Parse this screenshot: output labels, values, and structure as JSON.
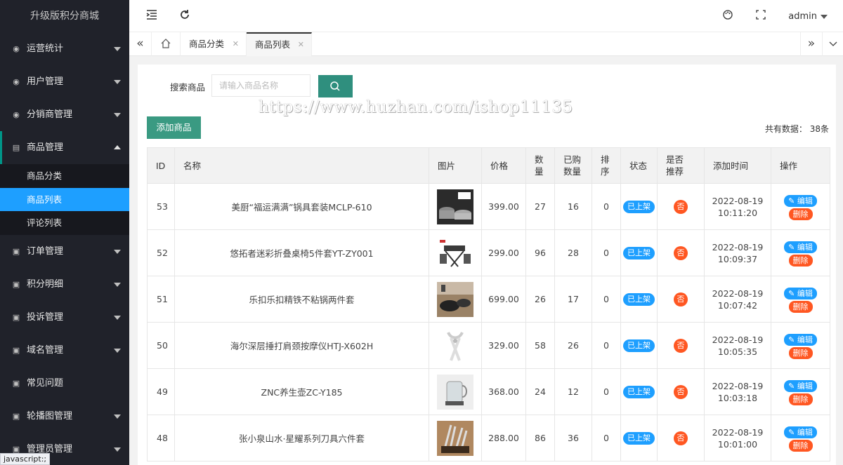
{
  "sidebar": {
    "logo": "升级版积分商城",
    "items": [
      {
        "label": "运营统计"
      },
      {
        "label": "用户管理"
      },
      {
        "label": "分销商管理"
      },
      {
        "label": "商品管理",
        "sub": [
          "商品分类",
          "商品列表",
          "评论列表"
        ]
      },
      {
        "label": "订单管理"
      },
      {
        "label": "积分明细"
      },
      {
        "label": "投诉管理"
      },
      {
        "label": "域名管理"
      },
      {
        "label": "常见问题"
      },
      {
        "label": "轮播图管理"
      },
      {
        "label": "管理员管理"
      }
    ]
  },
  "header": {
    "user": "admin"
  },
  "tabs": [
    {
      "label": "商品分类"
    },
    {
      "label": "商品列表"
    }
  ],
  "search": {
    "label": "搜索商品",
    "placeholder": "请输入商品名称"
  },
  "watermark": "https://www.huzhan.com/ishop11135",
  "add_button": "添加商品",
  "total": "共有数据： 38条",
  "table": {
    "headers": {
      "id": "ID",
      "name": "名称",
      "image": "图片",
      "price": "价格",
      "qty_1": "数",
      "qty_2": "量",
      "bought_1": "已购",
      "bought_2": "数量",
      "sort_1": "排",
      "sort_2": "序",
      "status": "状态",
      "rec_1": "是否",
      "rec_2": "推荐",
      "time": "添加时间",
      "ops": "操作"
    },
    "status_label": "已上架",
    "rec_label": "否",
    "edit_label": "✎ 编辑",
    "delete_label": "删除",
    "rows": [
      {
        "id": "53",
        "name": "美厨“福运满满”锅具套装MCLP-610",
        "price": "399.00",
        "qty": "27",
        "bought": "16",
        "sort": "0",
        "date": "2022-08-19",
        "time": "10:11:20",
        "img": "cookware-set"
      },
      {
        "id": "52",
        "name": "悠拓者迷彩折叠桌椅5件套YT-ZY001",
        "price": "299.00",
        "qty": "96",
        "bought": "28",
        "sort": "0",
        "date": "2022-08-19",
        "time": "10:09:37",
        "img": "folding-table"
      },
      {
        "id": "51",
        "name": "乐扣乐扣精铁不粘锅两件套",
        "price": "699.00",
        "qty": "26",
        "bought": "17",
        "sort": "0",
        "date": "2022-08-19",
        "time": "10:07:42",
        "img": "pans"
      },
      {
        "id": "50",
        "name": "海尔深层捶打肩颈按摩仪HTJ-X602H",
        "price": "329.00",
        "qty": "58",
        "bought": "26",
        "sort": "0",
        "date": "2022-08-19",
        "time": "10:05:35",
        "img": "massager"
      },
      {
        "id": "49",
        "name": "ZNC养生壶ZC-Y185",
        "price": "368.00",
        "qty": "24",
        "bought": "12",
        "sort": "0",
        "date": "2022-08-19",
        "time": "10:03:18",
        "img": "kettle"
      },
      {
        "id": "48",
        "name": "张小泉山水·星耀系列刀具六件套",
        "price": "288.00",
        "qty": "86",
        "bought": "36",
        "sort": "0",
        "date": "2022-08-19",
        "time": "10:01:00",
        "img": "knives"
      }
    ]
  },
  "statusbar": "javascript:;",
  "colors": {
    "sidebar_bg": "#20222a",
    "active_blue": "#1e9fff",
    "primary_green": "#009688",
    "danger": "#ff5722"
  }
}
